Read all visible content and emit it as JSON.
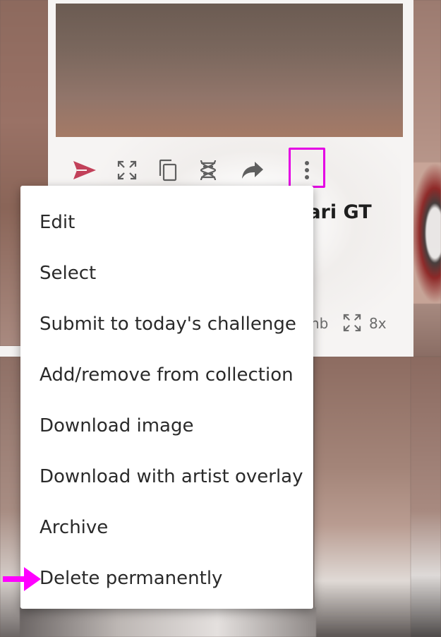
{
  "card": {
    "title_partial": "rari GT",
    "size_partial": "nb",
    "upscale_label": "8x",
    "toolbar_icons": [
      "send-icon",
      "expand-icon",
      "copy-icon",
      "dna-icon",
      "share-icon",
      "more-vert-icon"
    ]
  },
  "menu": {
    "items": [
      {
        "label": "Edit"
      },
      {
        "label": "Select"
      },
      {
        "label": "Submit to today's challenge"
      },
      {
        "label": "Add/remove from collection"
      },
      {
        "label": "Download image"
      },
      {
        "label": "Download with artist overlay"
      },
      {
        "label": "Archive"
      },
      {
        "label": "Delete permanently"
      }
    ]
  },
  "annotation": {
    "highlight_color": "#e400e4",
    "arrow_color": "#ff00ff"
  },
  "colors": {
    "send_accent": "#c2415a",
    "icon_gray": "#5f5f5f"
  }
}
